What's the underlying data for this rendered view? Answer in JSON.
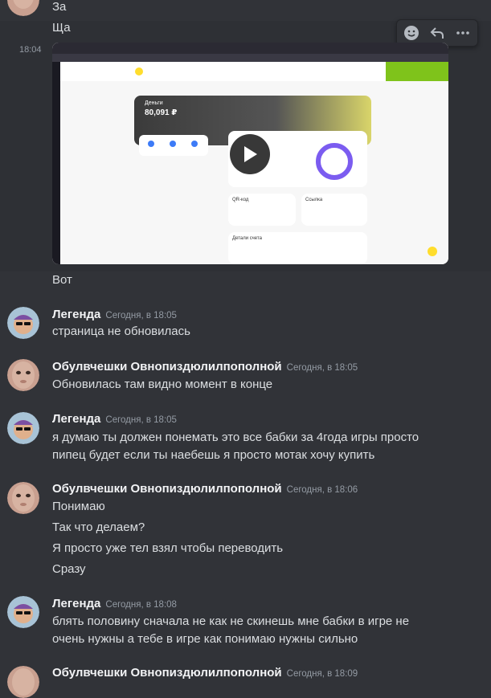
{
  "header_lines": [
    "За",
    "Ща"
  ],
  "video_message": {
    "timestamp": "18:04",
    "caption": "Вот",
    "preview": {
      "balance_label": "Деньги",
      "balance_value": "80,091 ₽",
      "qr_title": "QR-код",
      "link_title": "Ссылка",
      "details_title": "Детали счета"
    }
  },
  "toolbar": {
    "reaction_icon": "smile-icon",
    "reply_icon": "reply-icon",
    "more_icon": "more-icon"
  },
  "messages": [
    {
      "author": "Легенда",
      "time": "Сегодня, в 18:05",
      "lines": [
        "страница не обновилась"
      ]
    },
    {
      "author": "Обулвчешки Овнопиздюлилпополной",
      "time": "Сегодня, в 18:05",
      "lines": [
        "Обновилась там видно момент в конце"
      ]
    },
    {
      "author": "Легенда",
      "time": "Сегодня, в 18:05",
      "lines": [
        "я думаю ты должен понемать это все бабки за 4года игры просто",
        "пипец будет если ты наебешь я просто мотак хочу купить"
      ]
    },
    {
      "author": "Обулвчешки Овнопиздюлилпополной",
      "time": "Сегодня, в 18:06",
      "lines": [
        "Понимаю"
      ]
    },
    {
      "author": "Легенда",
      "time": "Сегодня, в 18:08",
      "lines": [
        "блять половину сначала не как не скинешь мне бабки в игре не",
        "очень нужны а тебе в игре как понимаю нужны сильно"
      ]
    },
    {
      "author": "Обулвчешки Овнопиздюлилпополной",
      "time": "Сегодня, в 18:09",
      "lines": []
    }
  ],
  "followups": [
    "Так что делаем?",
    "Я просто уже тел взял чтобы переводить",
    "Сразу"
  ],
  "colors": {
    "background": "#313338",
    "text": "#dbdee1",
    "author": "#f2f3f5",
    "muted": "#949ba4"
  }
}
